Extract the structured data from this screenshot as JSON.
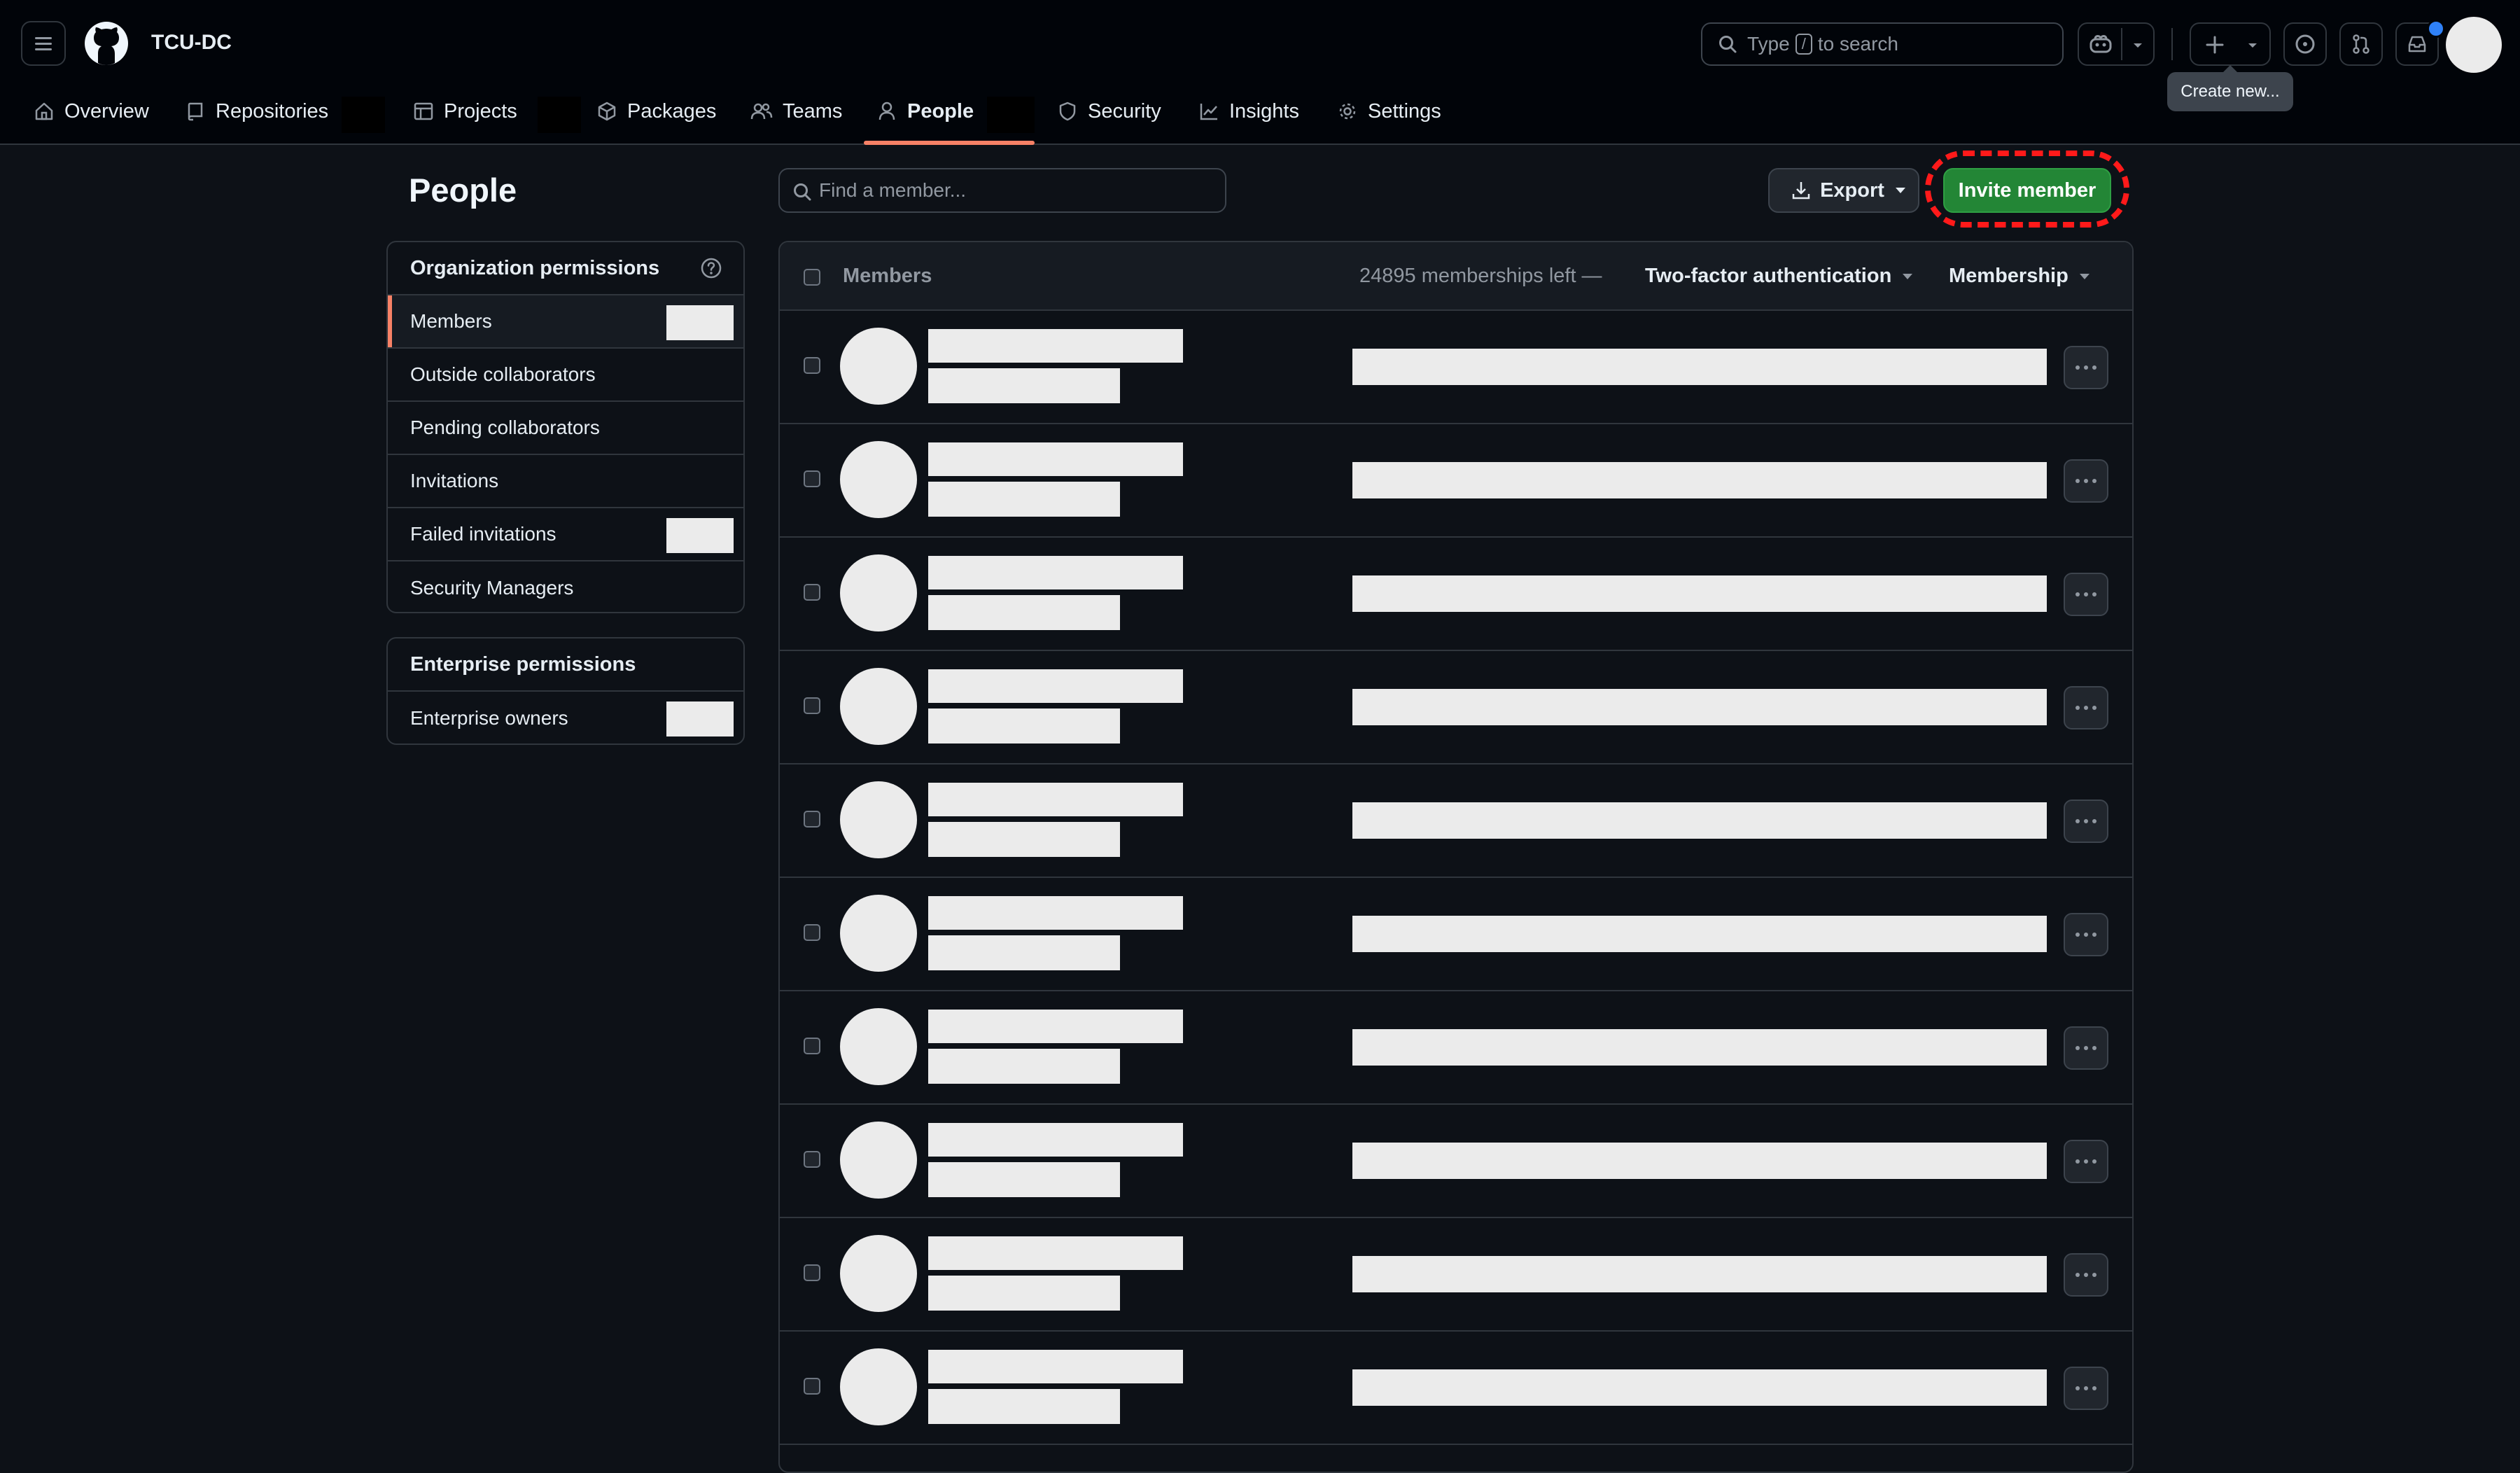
{
  "header": {
    "org_name": "TCU-DC",
    "search_prefix": "Type",
    "search_key": "/",
    "search_suffix": "to search",
    "tooltip": "Create new...",
    "colors": {
      "notification_dot": "#2f81f7"
    }
  },
  "tabs": [
    {
      "label": "Overview",
      "icon": "home-icon"
    },
    {
      "label": "Repositories",
      "icon": "repo-icon"
    },
    {
      "label": "Projects",
      "icon": "table-icon"
    },
    {
      "label": "Packages",
      "icon": "package-icon"
    },
    {
      "label": "Teams",
      "icon": "people-icon"
    },
    {
      "label": "People",
      "icon": "person-icon",
      "active": true
    },
    {
      "label": "Security",
      "icon": "shield-icon"
    },
    {
      "label": "Insights",
      "icon": "graph-icon"
    },
    {
      "label": "Settings",
      "icon": "gear-icon"
    }
  ],
  "page": {
    "title": "People"
  },
  "sidebar": {
    "org_permissions": {
      "heading": "Organization permissions",
      "items": [
        {
          "label": "Members",
          "active": true
        },
        {
          "label": "Outside collaborators"
        },
        {
          "label": "Pending collaborators"
        },
        {
          "label": "Invitations"
        },
        {
          "label": "Failed invitations"
        },
        {
          "label": "Security Managers"
        }
      ]
    },
    "enterprise_permissions": {
      "heading": "Enterprise permissions",
      "items": [
        {
          "label": "Enterprise owners"
        }
      ]
    }
  },
  "toolbar": {
    "find_placeholder": "Find a member...",
    "export_label": "Export",
    "invite_label": "Invite member",
    "colors": {
      "invite_bg": "#238636",
      "highlight_ring": "#ff1a1a"
    }
  },
  "list": {
    "header_label": "Members",
    "memberships_left": "24895 memberships left —",
    "filter_2fa": "Two-factor authentication",
    "filter_membership": "Membership",
    "row_count": 10
  }
}
